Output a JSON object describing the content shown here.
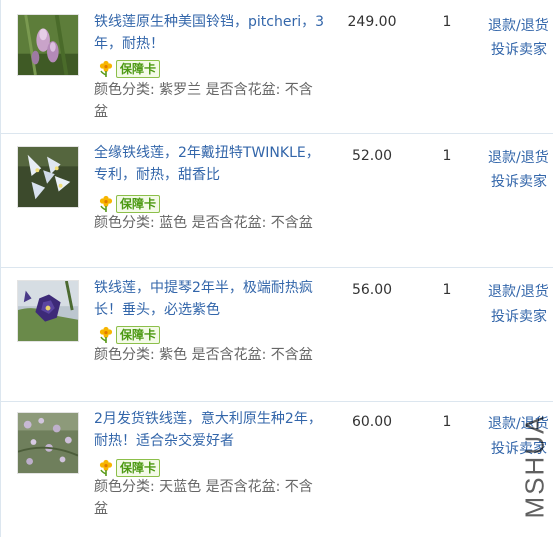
{
  "orders": [
    {
      "title": "铁线莲原生种美国铃铛，pitcheri，3年，耐热！",
      "badge": "保障卡",
      "attributes": "颜色分类: 紫罗兰 是否含花盆: 不含盆",
      "price": "249.00",
      "quantity": "1",
      "refund_label": "退款/退货",
      "complain_label": "投诉卖家",
      "thumb_icon": "clematis-pitcheri-photo"
    },
    {
      "title": "全缘铁线莲，2年戴扭特TWINKLE，专利，耐热，甜香比",
      "badge": "保障卡",
      "attributes": "颜色分类: 蓝色 是否含花盆: 不含盆",
      "price": "52.00",
      "quantity": "1",
      "refund_label": "退款/退货",
      "complain_label": "投诉卖家",
      "thumb_icon": "clematis-twinkle-photo"
    },
    {
      "title": "铁线莲，中提琴2年半，极端耐热疯长！垂头，必选紫色",
      "badge": "保障卡",
      "attributes": "颜色分类: 紫色 是否含花盆: 不含盆",
      "price": "56.00",
      "quantity": "1",
      "refund_label": "退款/退货",
      "complain_label": "投诉卖家",
      "thumb_icon": "clematis-viola-photo"
    },
    {
      "title": "2月发货铁线莲，意大利原生种2年，耐热！适合杂交爱好者",
      "badge": "保障卡",
      "attributes": "颜色分类: 天蓝色 是否含花盆: 不含盆",
      "price": "60.00",
      "quantity": "1",
      "refund_label": "退款/退货",
      "complain_label": "投诉卖家",
      "thumb_icon": "clematis-viticella-photo"
    }
  ],
  "watermark": "MSHUA",
  "colors": {
    "link": "#3366aa",
    "badge_green": "#4d9a14",
    "border": "#dce6ef"
  }
}
